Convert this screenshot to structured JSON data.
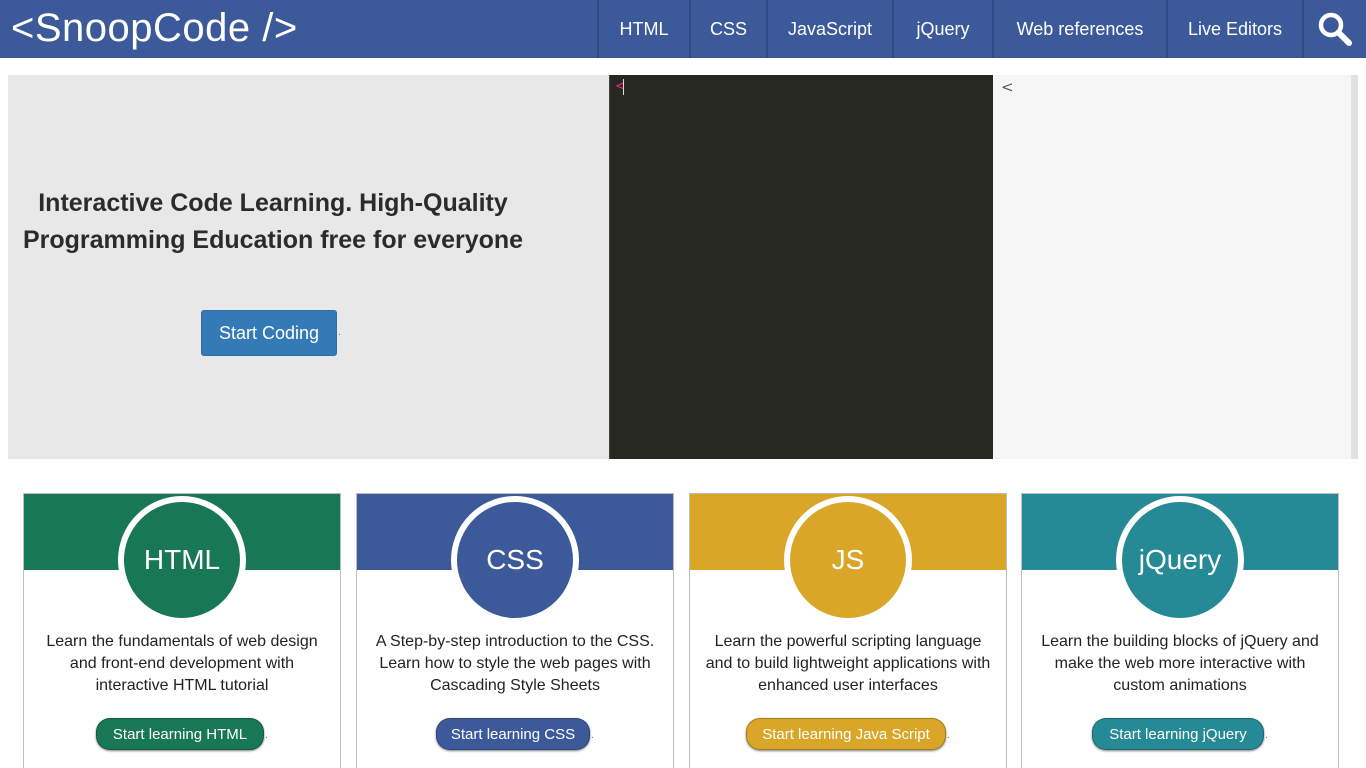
{
  "header": {
    "logo": "<SnoopCode />",
    "nav": [
      {
        "label": "HTML",
        "name": "nav-html",
        "width": 92
      },
      {
        "label": "CSS",
        "name": "nav-css",
        "width": 77
      },
      {
        "label": "JavaScript",
        "name": "nav-javascript",
        "width": 126
      },
      {
        "label": "jQuery",
        "name": "nav-jquery",
        "width": 100
      },
      {
        "label": "Web references",
        "name": "nav-web-references",
        "width": 174
      },
      {
        "label": "Live Editors",
        "name": "nav-live-editors",
        "width": 136
      }
    ],
    "search_icon": "search-icon"
  },
  "hero": {
    "title": "Interactive Code Learning. High-Quality Programming Education free for everyone",
    "button": "Start Coding",
    "dot": "."
  },
  "editor": {
    "content": "<",
    "preview": "<"
  },
  "cards": [
    {
      "badge": "HTML",
      "color": "#187755",
      "description": "Learn the fundamentals of web design and front-end development with interactive HTML tutorial",
      "button": "Start learning HTML"
    },
    {
      "badge": "CSS",
      "color": "#3c5a9a",
      "description": "A Step-by-step introduction to the CSS. Learn how to style the web pages with Cascading Style Sheets",
      "button": "Start learning CSS"
    },
    {
      "badge": "JS",
      "color": "#d9a628",
      "description": "Learn the powerful scripting language and to build lightweight applications with enhanced user interfaces",
      "button": "Start learning Java Script"
    },
    {
      "badge": "jQuery",
      "color": "#258a96",
      "description": "Learn the building blocks of jQuery and make the web more interactive with custom animations",
      "button": "Start learning jQuery"
    }
  ]
}
